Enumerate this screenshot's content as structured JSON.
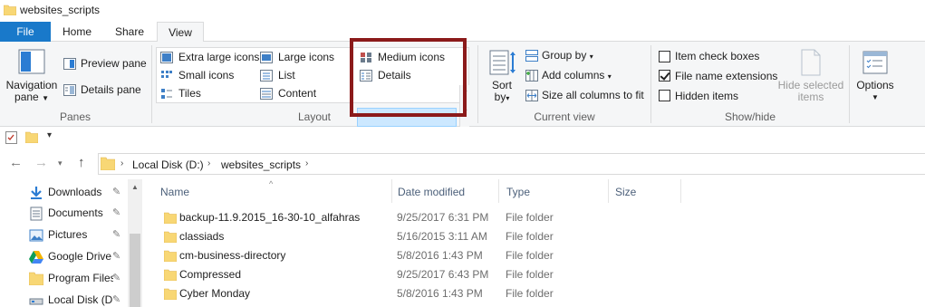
{
  "window": {
    "title": "websites_scripts"
  },
  "ribbon_tabs": [
    {
      "label": "File"
    },
    {
      "label": "Home"
    },
    {
      "label": "Share"
    },
    {
      "label": "View"
    }
  ],
  "ribbon": {
    "panes": {
      "group_label": "Panes",
      "navigation_pane": {
        "line1": "Navigation",
        "line2": "pane"
      },
      "preview_pane": "Preview pane",
      "details_pane": "Details pane"
    },
    "layout": {
      "group_label": "Layout",
      "options": [
        {
          "label": "Extra large icons",
          "icon": "extra-large-icons-icon"
        },
        {
          "label": "Large icons",
          "icon": "large-icons-icon"
        },
        {
          "label": "Medium icons",
          "icon": "medium-icons-icon"
        },
        {
          "label": "Small icons",
          "icon": "small-icons-icon"
        },
        {
          "label": "List",
          "icon": "list-icon"
        },
        {
          "label": "Details",
          "icon": "details-icon",
          "selected": true
        },
        {
          "label": "Tiles",
          "icon": "tiles-icon"
        },
        {
          "label": "Content",
          "icon": "content-icon"
        }
      ]
    },
    "current_view": {
      "group_label": "Current view",
      "sort_by": {
        "line1": "Sort",
        "line2": "by"
      },
      "group_by": "Group by",
      "add_columns": "Add columns",
      "size_all_columns": "Size all columns to fit"
    },
    "show_hide": {
      "group_label": "Show/hide",
      "item_check_boxes": {
        "label": "Item check boxes",
        "checked": false
      },
      "file_name_extensions": {
        "label": "File name extensions",
        "checked": true
      },
      "hidden_items": {
        "label": "Hidden items",
        "checked": false
      },
      "hide_selected": {
        "line1": "Hide selected",
        "line2": "items"
      }
    },
    "options": {
      "label": "Options"
    }
  },
  "address": {
    "crumbs": [
      "Local Disk (D:)",
      "websites_scripts"
    ]
  },
  "nav_pane": {
    "items": [
      {
        "label": "Downloads",
        "icon": "download-icon",
        "pinned": true
      },
      {
        "label": "Documents",
        "icon": "documents-icon",
        "pinned": true
      },
      {
        "label": "Pictures",
        "icon": "pictures-icon",
        "pinned": true
      },
      {
        "label": "Google Drive",
        "icon": "google-drive-icon",
        "pinned": true
      },
      {
        "label": "Program Files",
        "icon": "folder-icon",
        "pinned": true
      },
      {
        "label": "Local Disk (D:)",
        "icon": "drive-icon",
        "pinned": true
      }
    ]
  },
  "file_list": {
    "columns": [
      "Name",
      "Date modified",
      "Type",
      "Size"
    ],
    "rows": [
      {
        "name": "backup-11.9.2015_16-30-10_alfahras",
        "date": "9/25/2017 6:31 PM",
        "type": "File folder"
      },
      {
        "name": "classiads",
        "date": "5/16/2015 3:11 AM",
        "type": "File folder"
      },
      {
        "name": "cm-business-directory",
        "date": "5/8/2016 1:43 PM",
        "type": "File folder"
      },
      {
        "name": "Compressed",
        "date": "9/25/2017 6:43 PM",
        "type": "File folder"
      },
      {
        "name": "Cyber Monday",
        "date": "5/8/2016 1:43 PM",
        "type": "File folder"
      }
    ]
  },
  "colors": {
    "file_tab": "#1979ca",
    "ribbon_bg": "#f5f6f7",
    "selection": "#cce8ff",
    "annotation": "#8b1a1a",
    "folder": "#f8d775"
  }
}
